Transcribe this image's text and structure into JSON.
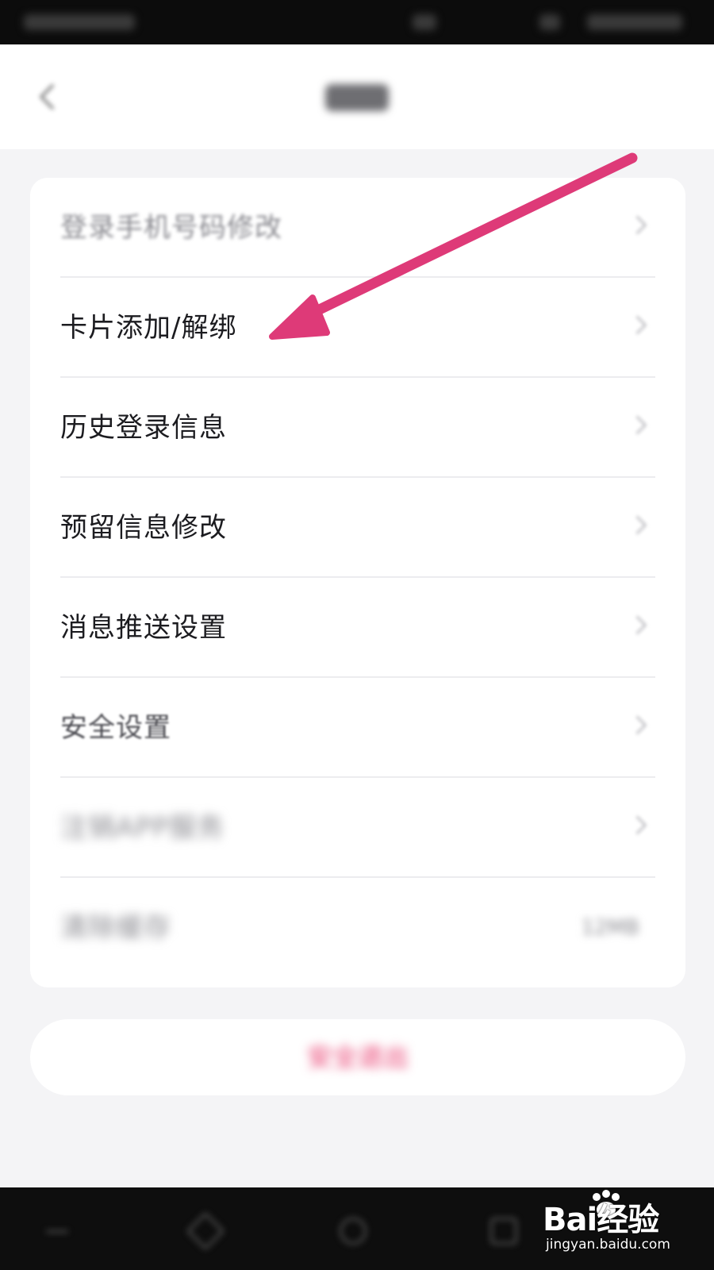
{
  "nav": {
    "title": "设置"
  },
  "settings": {
    "items": [
      {
        "label": "登录手机号码修改"
      },
      {
        "label": "卡片添加/解绑"
      },
      {
        "label": "历史登录信息"
      },
      {
        "label": "预留信息修改"
      },
      {
        "label": "消息推送设置"
      },
      {
        "label": "安全设置"
      },
      {
        "label": "注销APP服务"
      },
      {
        "label": "清除缓存",
        "value": "12MB"
      }
    ]
  },
  "logout": {
    "label": "安全退出"
  },
  "watermark": {
    "brand": "Bai经验",
    "url": "jingyan.baidu.com"
  },
  "colors": {
    "accent": "#e8396c",
    "annotation_arrow": "#de3a78"
  },
  "icons": [
    "back-arrow-icon",
    "chevron-right-icon",
    "annotation-arrow-icon",
    "paw-icon"
  ]
}
